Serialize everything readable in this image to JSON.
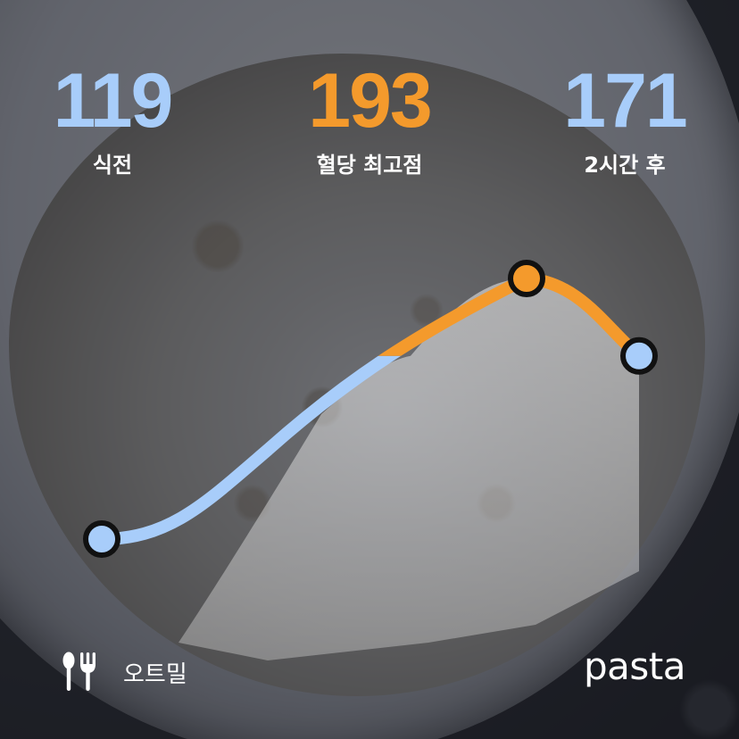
{
  "readings": {
    "before": {
      "value": "119",
      "label": "식전"
    },
    "peak": {
      "value": "193",
      "label": "혈당 최고점"
    },
    "after": {
      "value": "171",
      "label": "2시간 후"
    }
  },
  "food": {
    "icon": "utensils-icon",
    "name": "오트밀"
  },
  "brand": {
    "logo_text": "pasta"
  },
  "colors": {
    "normal": "#a8cdfa",
    "spike": "#f49a2c",
    "marker_outline": "#111111",
    "text": "#ffffff"
  },
  "chart_data": {
    "type": "line",
    "x_stages": [
      "식전",
      "혈당 최고점",
      "2시간 후"
    ],
    "values": [
      119,
      193,
      171
    ],
    "highlight_above": 171
  }
}
